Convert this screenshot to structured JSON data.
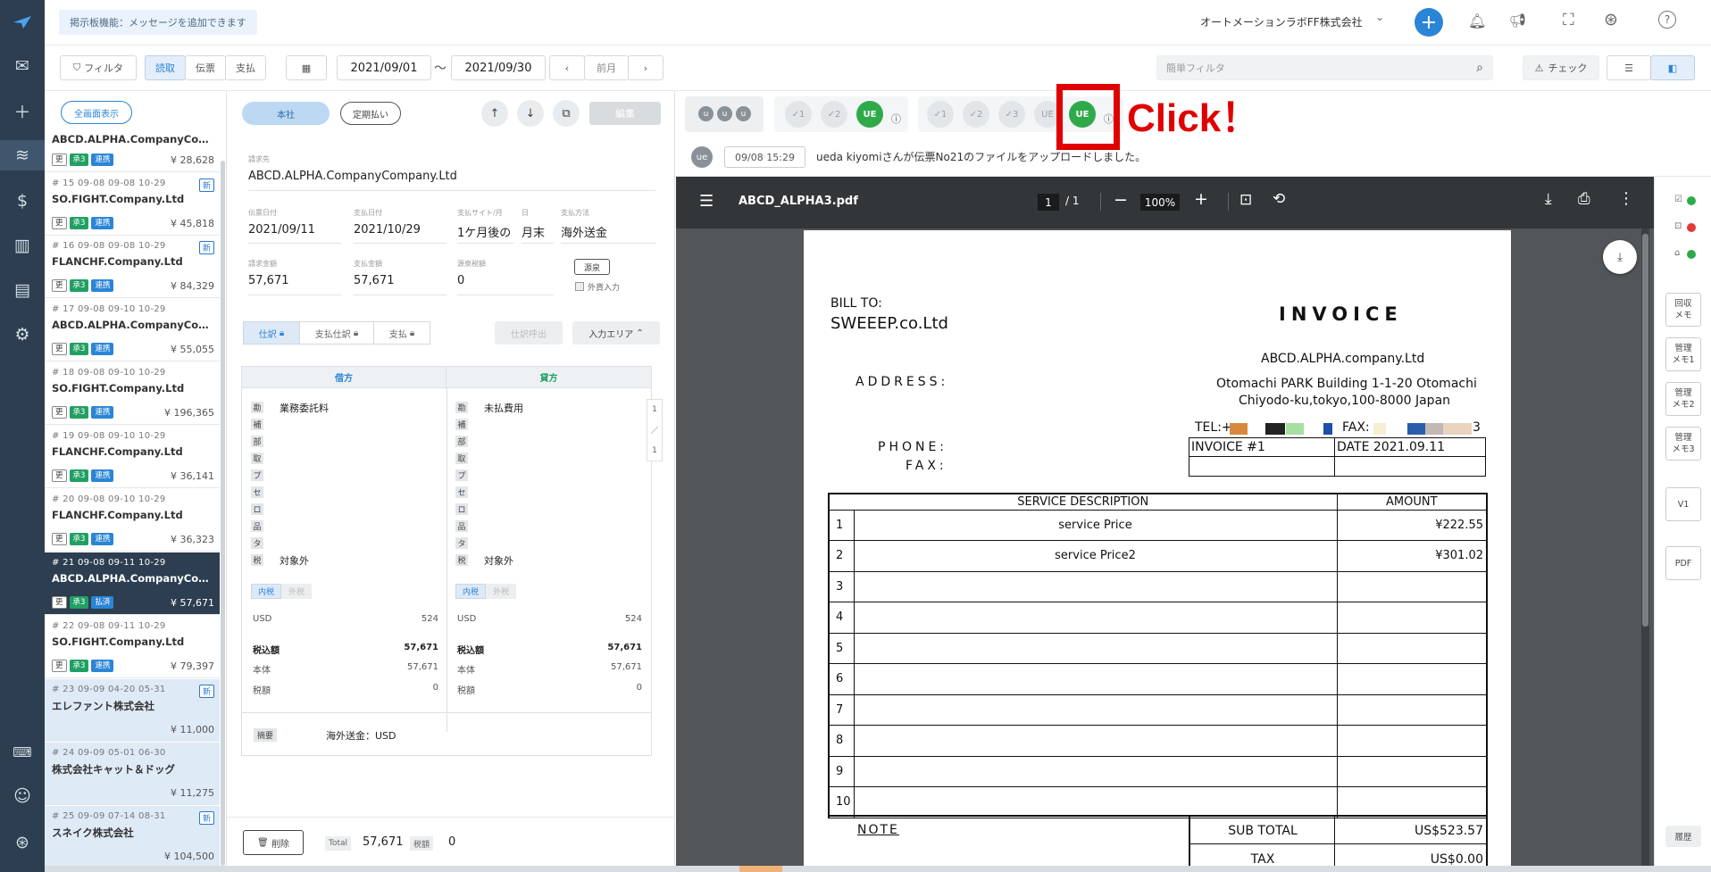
{
  "topbar": {
    "notice": "掲示板機能：メッセージを追加できます",
    "company": "オートメーションラボFF株式会社",
    "chevron": "⌄"
  },
  "toolbar": {
    "filter_label": "フィルタ",
    "tabs": [
      "読取",
      "伝票",
      "支払"
    ],
    "date_from": "2021/09/01",
    "tilde": "〜",
    "date_to": "2021/09/30",
    "prev_month_label": "前月",
    "quick_filter_placeholder": "簡単フィルタ",
    "check_label": "チェック"
  },
  "list": {
    "fullscreen_label": "全画面表示",
    "items": [
      {
        "meta": "",
        "name": "ABCD.ALPHA.CompanyComp…",
        "amount": "¥ 28,628",
        "tags": [
          "更",
          "承3",
          "連携"
        ],
        "new": false,
        "state": "normal"
      },
      {
        "meta": "# 15  09-08  09-08  10-29",
        "name": "SO.FIGHT.Company.Ltd",
        "amount": "¥ 45,818",
        "tags": [
          "更",
          "承3",
          "連携"
        ],
        "new": true,
        "state": "normal"
      },
      {
        "meta": "# 16  09-08  09-08  10-29",
        "name": "FLANCHF.Company.Ltd",
        "amount": "¥ 84,329",
        "tags": [
          "更",
          "承3",
          "連携"
        ],
        "new": true,
        "state": "normal"
      },
      {
        "meta": "# 17  09-08  09-10  10-29",
        "name": "ABCD.ALPHA.CompanyComp…",
        "amount": "¥ 55,055",
        "tags": [
          "更",
          "承3",
          "連携"
        ],
        "new": false,
        "state": "normal"
      },
      {
        "meta": "# 18  09-08  09-10  10-29",
        "name": "SO.FIGHT.Company.Ltd",
        "amount": "¥ 196,365",
        "tags": [
          "更",
          "承3",
          "連携"
        ],
        "new": false,
        "state": "normal"
      },
      {
        "meta": "# 19  09-08  09-10  10-29",
        "name": "FLANCHF.Company.Ltd",
        "amount": "¥ 36,141",
        "tags": [
          "更",
          "承3",
          "連携"
        ],
        "new": false,
        "state": "normal"
      },
      {
        "meta": "# 20  09-08  09-10  10-29",
        "name": "FLANCHF.Company.Ltd",
        "amount": "¥ 36,323",
        "tags": [
          "更",
          "承3",
          "連携"
        ],
        "new": false,
        "state": "normal"
      },
      {
        "meta": "# 21  09-08  09-11  10-29",
        "name": "ABCD.ALPHA.CompanyComp…",
        "amount": "¥ 57,671",
        "tags": [
          "更",
          "承3",
          "払済"
        ],
        "new": false,
        "state": "sel"
      },
      {
        "meta": "# 22  09-08  09-11  10-29",
        "name": "SO.FIGHT.Company.Ltd",
        "amount": "¥ 79,397",
        "tags": [
          "更",
          "承3",
          "連携"
        ],
        "new": false,
        "state": "normal"
      },
      {
        "meta": "# 23  09-09  04-20  05-31",
        "name": "エレファント株式会社",
        "amount": "¥ 11,000",
        "tags": [],
        "new": true,
        "state": "blue"
      },
      {
        "meta": "# 24  09-09  05-01  06-30",
        "name": "株式会社キャット＆ドッグ",
        "amount": "¥ 11,275",
        "tags": [],
        "new": false,
        "state": "blue"
      },
      {
        "meta": "# 25  09-09  07-14  08-31",
        "name": "スネイク株式会社",
        "amount": "¥ 104,500",
        "tags": [],
        "new": true,
        "state": "blue"
      }
    ]
  },
  "detail": {
    "tab_main": "本社",
    "tab_recurring": "定期払い",
    "edit_label": "編集",
    "billing_label": "請求先",
    "billing_value": "ABCD.ALPHA.CompanyCompany.Ltd",
    "invoice_date_label": "伝票日付",
    "invoice_date": "2021/09/11",
    "pay_date_label": "支払日付",
    "pay_date": "2021/10/29",
    "site_label": "支払サイト/月",
    "site_value": "1ケ月後の",
    "day_label": "日",
    "day_value": "月末",
    "method_label": "支払方法",
    "method_value": "海外送金",
    "bill_amount_label": "請求金額",
    "bill_amount": "57,671",
    "pay_amount_label": "支払金額",
    "pay_amount": "57,671",
    "withholding_label": "源泉税額",
    "withholding_value": "0",
    "gensen_btn": "源泉",
    "foreign_input": "外貨入力",
    "jtabs": [
      "仕訳",
      "支払仕訳",
      "支払"
    ],
    "jcall": "仕訳呼出",
    "input_area": "入力エリア",
    "debit": "借方",
    "credit": "貸方",
    "kchars": [
      "勘",
      "補",
      "部",
      "取",
      "プ",
      "セ",
      "ロ",
      "品",
      "タ",
      "税"
    ],
    "debit_account": "業務委託料",
    "credit_account": "未払費用",
    "debit_tax": "対象外",
    "credit_tax": "対象外",
    "incl": "内税",
    "excl": "外税",
    "currency": "USD",
    "currency_amt": "524",
    "tax_incl_label": "税込額",
    "tax_incl": "57,671",
    "body_label": "本体",
    "body": "57,671",
    "tax_label": "税額",
    "tax": "0",
    "pager_top": "1",
    "pager_sep": "／",
    "pager_bottom": "1",
    "summary_label": "摘要",
    "summary_value": "海外送金：USD",
    "delete_label": "削除",
    "total_label": "Total",
    "total_value": "57,671",
    "tax_tag": "税額",
    "tax_value": "0"
  },
  "approval": {
    "u": "u",
    "checks1": [
      "1",
      "2"
    ],
    "ue": "UE",
    "checks2": [
      "1",
      "2",
      "3"
    ],
    "ue_gray": "UE",
    "click_label": "Click！"
  },
  "log": {
    "avatar": "ue",
    "time": "09/08 15:29",
    "message": "ueda kiyomiさんが伝票No21のファイルをアップロードしました。"
  },
  "pdf": {
    "filename": "ABCD_ALPHA3.pdf",
    "page": "1",
    "page_total": "/  1",
    "zoom": "100%"
  },
  "invoice": {
    "bill_to": "BILL TO:",
    "bill_company": "SWEEEP.co.Ltd",
    "title": "INVOICE",
    "from_company": "ABCD.ALPHA.company.Ltd",
    "address_label": "ADDRESS:",
    "address_line1": "Otomachi PARK Building 1-1-20 Otomachi",
    "address_line2": "Chiyodo-ku,tokyo,100-8000 Japan",
    "tel_label": "TEL:+",
    "fax_label": "FAX:",
    "fax_end": "3",
    "phone_label": "PHONE:",
    "fax_label2": "FAX:",
    "invoice_no": "INVOICE #1",
    "date": "DATE 2021.09.11",
    "col_desc": "SERVICE DESCRIPTION",
    "col_amount": "AMOUNT",
    "rows": [
      {
        "n": "1",
        "desc": "service Price",
        "amt": "¥222.55"
      },
      {
        "n": "2",
        "desc": "service Price2",
        "amt": "¥301.02"
      },
      {
        "n": "3",
        "desc": "",
        "amt": ""
      },
      {
        "n": "4",
        "desc": "",
        "amt": ""
      },
      {
        "n": "5",
        "desc": "",
        "amt": ""
      },
      {
        "n": "6",
        "desc": "",
        "amt": ""
      },
      {
        "n": "7",
        "desc": "",
        "amt": ""
      },
      {
        "n": "8",
        "desc": "",
        "amt": ""
      },
      {
        "n": "9",
        "desc": "",
        "amt": ""
      },
      {
        "n": "10",
        "desc": "",
        "amt": ""
      }
    ],
    "note": "NOTE",
    "subtotal_label": "SUB  TOTAL",
    "subtotal": "US$523.57",
    "tax_label": "TAX",
    "tax": "US$0.00"
  },
  "side_panel": {
    "memos": [
      "回収\nメモ",
      "管理\nメモ1",
      "管理\nメモ2",
      "管理\nメモ3"
    ],
    "v1": "V1",
    "pdf": "PDF",
    "history": "履歴"
  },
  "colors": {
    "sidebar": "#2c3e50",
    "accent": "#2b85d6",
    "green": "#2faa4a",
    "highlight": "#e00000"
  }
}
